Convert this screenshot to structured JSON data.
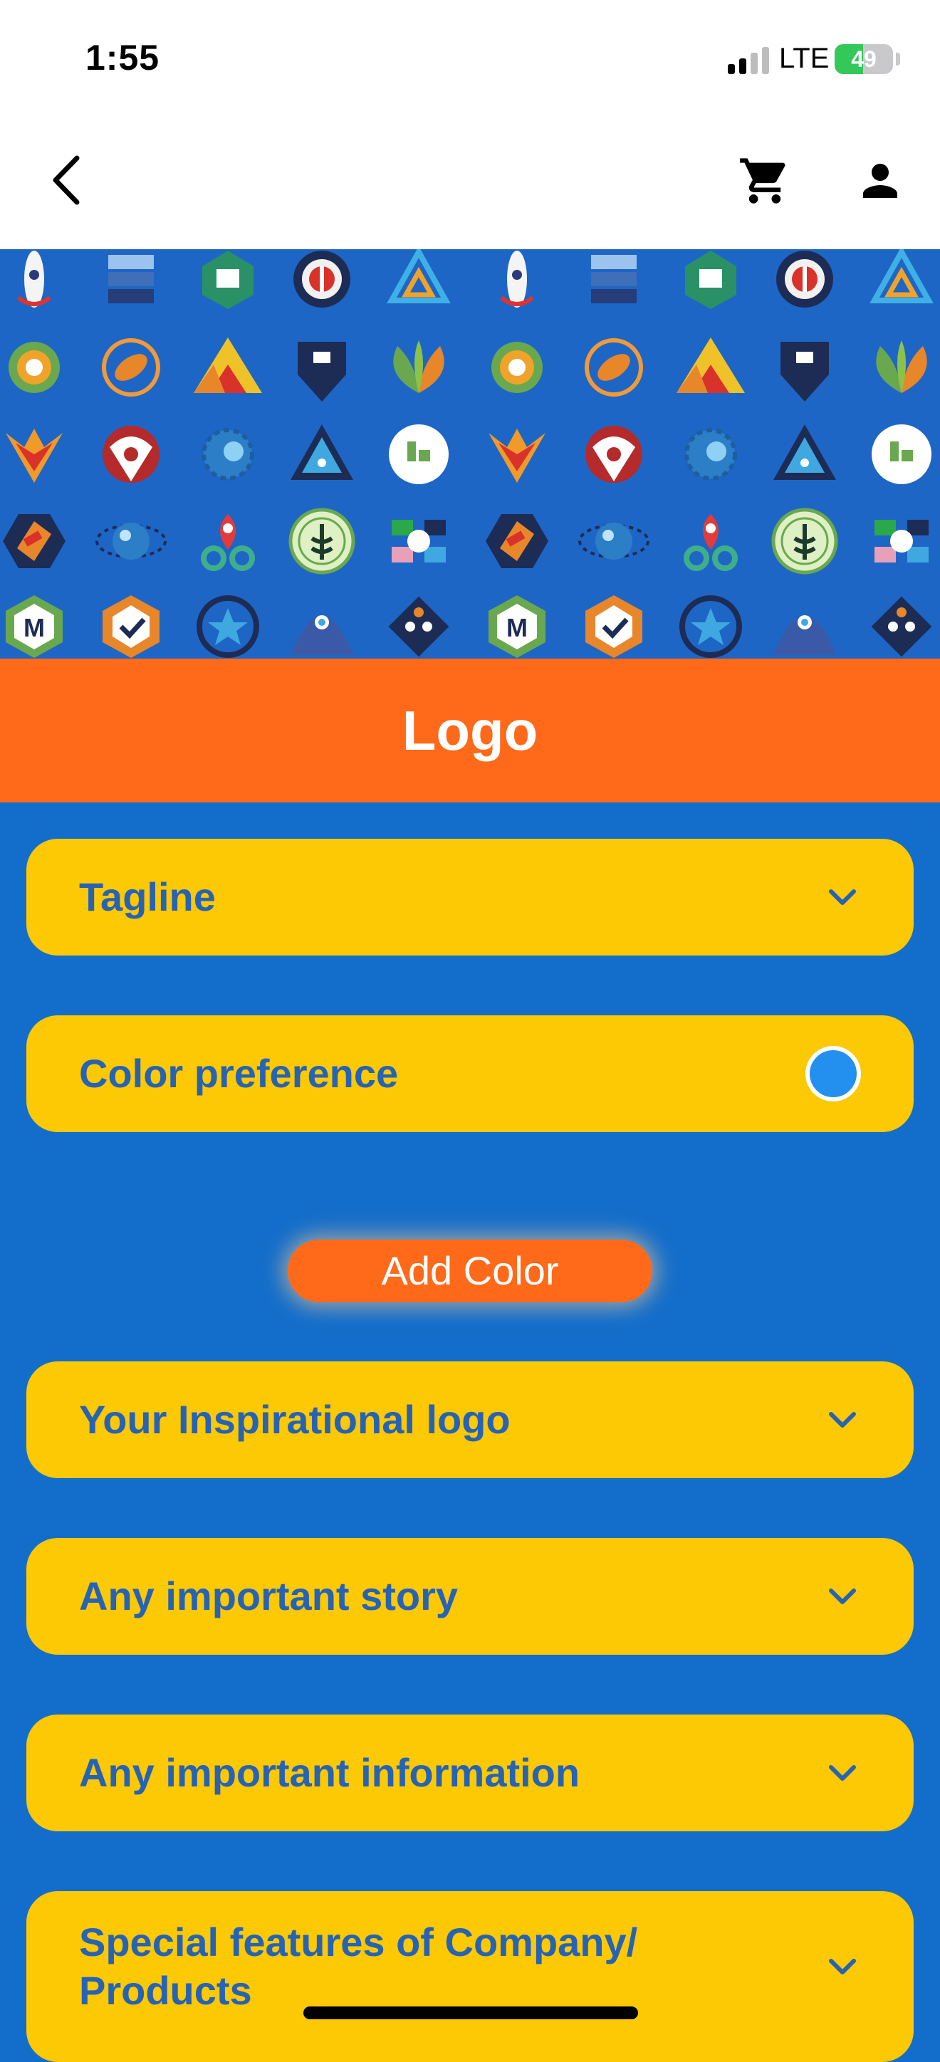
{
  "status_bar": {
    "time": "1:55",
    "network": "LTE",
    "battery": "49",
    "battery_level": 0.49
  },
  "nav": {
    "back": "back-icon",
    "cart": "cart-icon",
    "profile": "person-icon"
  },
  "page": {
    "title": "Logo"
  },
  "form": {
    "tagline_label": "Tagline",
    "color_preference_label": "Color preference",
    "selected_color": "#2390f0",
    "add_color_label": "Add Color",
    "inspirational_logo_label": "Your Inspirational logo",
    "important_story_label": "Any important story",
    "important_information_label": "Any important information",
    "special_features_label": "Special features of Company/ Products"
  },
  "colors": {
    "accent_orange": "#fe6a1a",
    "field_yellow": "#fdc804",
    "background_blue": "#136ecb",
    "label_blue": "#2663b4"
  }
}
